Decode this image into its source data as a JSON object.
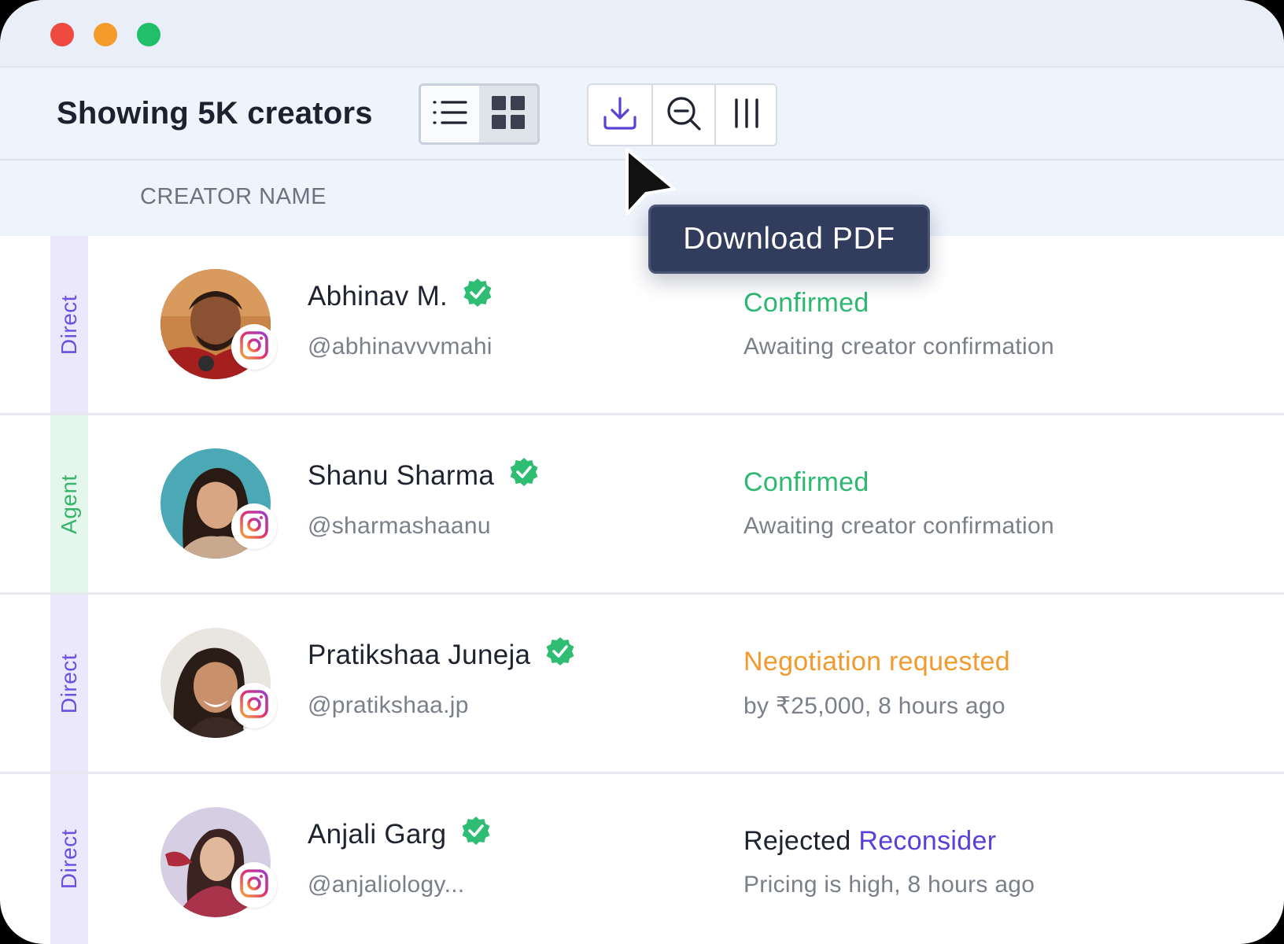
{
  "window": {
    "controls": [
      "close",
      "minimize",
      "maximize"
    ]
  },
  "toolbar": {
    "title": "Showing 5K creators",
    "view_toggle": {
      "options": [
        "list-icon",
        "grid-icon"
      ],
      "selected": "list-icon"
    },
    "actions": [
      "download-icon",
      "zoom-out-icon",
      "columns-icon"
    ]
  },
  "tooltip": {
    "text": "Download PDF"
  },
  "table": {
    "column_header": "CREATOR NAME",
    "rows": [
      {
        "tag": "Direct",
        "name": "Abhinav M.",
        "handle": "@abhinavvvmahi",
        "status": "Confirmed",
        "substatus": "Awaiting creator confirmation",
        "status_color": "#2eb872"
      },
      {
        "tag": "Agent",
        "name": "Shanu Sharma",
        "handle": "@sharmashaanu",
        "status": "Confirmed",
        "substatus": "Awaiting creator confirmation",
        "status_color": "#2eb872"
      },
      {
        "tag": "Direct",
        "name": "Pratikshaa Juneja",
        "handle": "@pratikshaa.jp",
        "status": "Negotiation requested",
        "substatus": "by ₹25,000, 8 hours ago",
        "status_color": "#f29a2e"
      },
      {
        "tag": "Direct",
        "name": "Anjali Garg",
        "handle": "@anjaliology...",
        "status": "Rejected",
        "status_action": "Reconsider",
        "substatus": "Pricing is high, 8 hours ago",
        "status_color": "#1f2330"
      }
    ]
  },
  "colors": {
    "accent": "#5b3fd9",
    "direct_tag_bg": "#ece8fb",
    "direct_tag_text": "#6a4fe0",
    "agent_tag_bg": "#e5f6ec",
    "agent_tag_text": "#36b56a",
    "verified": "#2ebd73",
    "confirmed": "#2eb872",
    "negotiation": "#f29a2e"
  }
}
